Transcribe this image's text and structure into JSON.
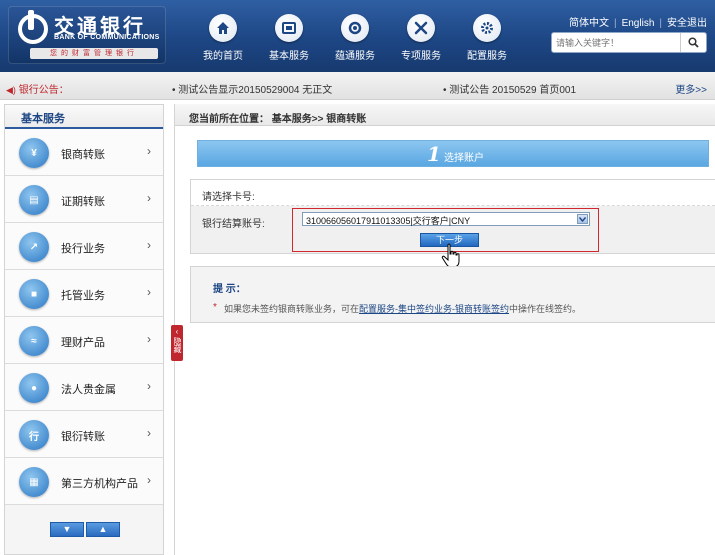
{
  "header": {
    "logo_cn": "交通银行",
    "logo_en": "BANK OF COMMUNICATIONS",
    "logo_slogan": "您的财富管理银行",
    "nav": [
      {
        "label": "我的首页",
        "icon": "home-icon"
      },
      {
        "label": "基本服务",
        "icon": "card-icon"
      },
      {
        "label": "蕴通服务",
        "icon": "swirl-icon"
      },
      {
        "label": "专项服务",
        "icon": "tools-icon"
      },
      {
        "label": "配置服务",
        "icon": "gear-icon"
      }
    ],
    "top_links": [
      "简体中文",
      "English",
      "安全退出"
    ],
    "search_placeholder": "请输入关键字！"
  },
  "announcement": {
    "label": "银行公告：",
    "items": [
      "测试公告显示20150529004 无正文",
      "测试公告 20150529 首页001"
    ],
    "more": "更多>>"
  },
  "sidebar": {
    "title": "基本服务",
    "items": [
      {
        "label": "银商转账",
        "icon": "bank-transfer-icon"
      },
      {
        "label": "证期转账",
        "icon": "securities-icon"
      },
      {
        "label": "投行业务",
        "icon": "investment-icon"
      },
      {
        "label": "托管业务",
        "icon": "custody-icon"
      },
      {
        "label": "理财产品",
        "icon": "wealth-icon"
      },
      {
        "label": "法人贵金属",
        "icon": "person-icon"
      },
      {
        "label": "银衍转账",
        "icon": "bank-derivative-icon"
      },
      {
        "label": "第三方机构产品",
        "icon": "third-party-icon"
      }
    ],
    "hide_tab": "隐藏"
  },
  "main": {
    "breadcrumb": "您当前所在位置： 基本服务>> 银商转账",
    "step_number": "1",
    "step_label": "选择账户",
    "select_card_label": "请选择卡号:",
    "account_label": "银行结算账号:",
    "account_value": "310066056017911013305|交行客户|CNY",
    "next_button": "下一步",
    "tip_title": "提 示：",
    "tip_star": "*",
    "tip_text_before": "如果您未签约银商转账业务，可在",
    "tip_link": "配置服务-集中签约业务-银商转账签约",
    "tip_text_after": "中操作在线签约。"
  }
}
